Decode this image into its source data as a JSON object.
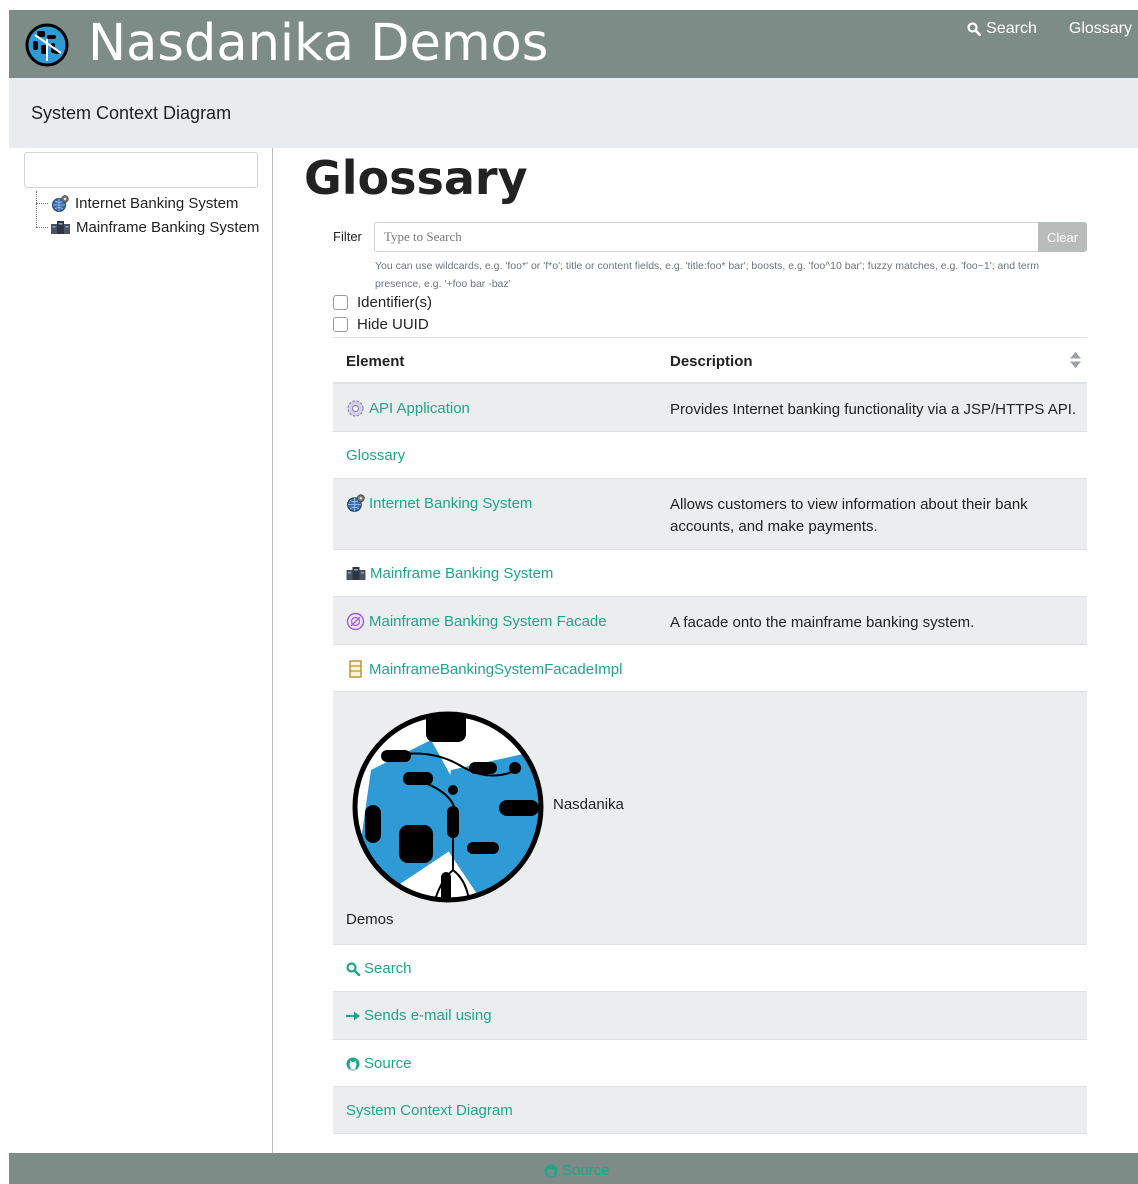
{
  "header": {
    "site_title": "Nasdanika Demos",
    "nav": [
      {
        "label": "Search",
        "icon": "search-icon"
      },
      {
        "label": "Glossary"
      }
    ]
  },
  "breadcrumb": "System Context Diagram",
  "sidebar": {
    "search_value": "",
    "tree": [
      {
        "label": "Internet Banking System",
        "icon": "globe-gear-icon"
      },
      {
        "label": "Mainframe Banking System",
        "icon": "server-icon"
      }
    ]
  },
  "main": {
    "title": "Glossary",
    "filter": {
      "label": "Filter",
      "placeholder": "Type to Search",
      "clear_label": "Clear",
      "help": "You can use wildcards, e.g. 'foo*' or 'f*o'; title or content fields, e.g. 'title:foo* bar'; boosts, e.g. 'foo^10 bar'; fuzzy matches, e.g. 'foo~1'; and term presence, e.g. '+foo bar -baz'"
    },
    "checkboxes": [
      {
        "label": "Identifier(s)",
        "checked": false
      },
      {
        "label": "Hide UUID",
        "checked": false
      }
    ],
    "table": {
      "headers": [
        "Element",
        "Description"
      ],
      "rows": [
        {
          "element": "API Application",
          "description": "Provides Internet banking functionality via a JSP/HTTPS API.",
          "icon": "gear-icon"
        },
        {
          "element": "Glossary",
          "description": ""
        },
        {
          "element": "Internet Banking System",
          "description": "Allows customers to view information about their bank accounts, and make payments.",
          "icon": "globe-gear-icon"
        },
        {
          "element": "Mainframe Banking System",
          "description": "",
          "icon": "server-icon"
        },
        {
          "element": "Mainframe Banking System Facade",
          "description": "A facade onto the mainframe banking system.",
          "icon": "facade-icon"
        },
        {
          "element": "MainframeBankingSystemFacadeImpl",
          "description": "",
          "icon": "class-icon"
        },
        {
          "element": "Demos",
          "description": "",
          "logo_label": "Nasdanika",
          "icon": "nasdanika-logo-icon"
        },
        {
          "element": "Search",
          "description": "",
          "icon": "search-icon"
        },
        {
          "element": "Sends e-mail using",
          "description": "",
          "icon": "arrow-right-icon"
        },
        {
          "element": "Source",
          "description": "",
          "icon": "github-icon"
        },
        {
          "element": "System Context Diagram",
          "description": ""
        }
      ]
    }
  },
  "footer": {
    "source_label": "Source",
    "icon": "github-icon"
  },
  "colors": {
    "header_bg": "#7e8c88",
    "link": "#1fa58a",
    "breadcrumb_bg": "#e9ecef"
  }
}
